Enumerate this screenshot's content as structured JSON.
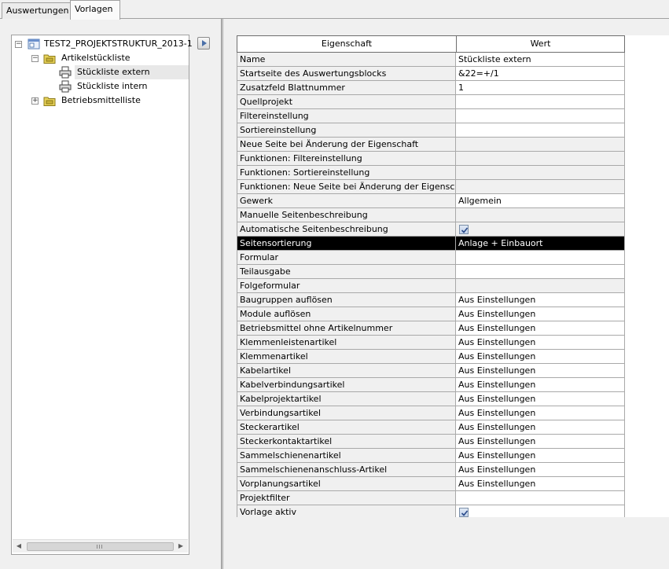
{
  "tabs": [
    {
      "label": "Auswertungen",
      "active": false
    },
    {
      "label": "Vorlagen",
      "active": true
    }
  ],
  "tree": {
    "root": "TEST2_PROJEKTSTRUKTUR_2013-1",
    "items": [
      {
        "label": "Artikelstückliste",
        "expander": "−"
      },
      {
        "label": "Stückliste extern",
        "selected": true
      },
      {
        "label": "Stückliste intern"
      },
      {
        "label": "Betriebsmittelliste",
        "expander": "+"
      }
    ]
  },
  "grid": {
    "header": {
      "property": "Eigenschaft",
      "value": "Wert"
    },
    "rows": [
      {
        "property": "Name",
        "value": "Stückliste extern"
      },
      {
        "property": "Startseite des Auswertungsblocks",
        "value": "&22=+/1"
      },
      {
        "property": "Zusatzfeld Blattnummer",
        "value": "1"
      },
      {
        "property": "Quellprojekt",
        "value": ""
      },
      {
        "property": "Filtereinstellung",
        "value": ""
      },
      {
        "property": "Sortiereinstellung",
        "value": ""
      },
      {
        "property": "Neue Seite bei Änderung der Eigenschaft",
        "value": "",
        "gray": true
      },
      {
        "property": "Funktionen: Filtereinstellung",
        "value": "",
        "gray": true
      },
      {
        "property": "Funktionen: Sortiereinstellung",
        "value": "",
        "gray": true
      },
      {
        "property": "Funktionen: Neue Seite bei Änderung der Eigensc...",
        "value": "",
        "gray": true
      },
      {
        "property": "Gewerk",
        "value": "Allgemein"
      },
      {
        "property": "Manuelle Seitenbeschreibung",
        "value": "",
        "gray": true
      },
      {
        "property": "Automatische Seitenbeschreibung",
        "value": "",
        "checkbox": true,
        "gray": true
      },
      {
        "property": "Seitensortierung",
        "value": "Anlage + Einbauort",
        "highlight": true
      },
      {
        "property": "Formular",
        "value": ""
      },
      {
        "property": "Teilausgabe",
        "value": ""
      },
      {
        "property": "Folgeformular",
        "value": "",
        "gray": true
      },
      {
        "property": "Baugruppen auflösen",
        "value": "Aus Einstellungen"
      },
      {
        "property": "Module auflösen",
        "value": "Aus Einstellungen"
      },
      {
        "property": "Betriebsmittel ohne Artikelnummer",
        "value": "Aus Einstellungen"
      },
      {
        "property": "Klemmenleistenartikel",
        "value": "Aus Einstellungen"
      },
      {
        "property": "Klemmenartikel",
        "value": "Aus Einstellungen"
      },
      {
        "property": "Kabelartikel",
        "value": "Aus Einstellungen"
      },
      {
        "property": "Kabelverbindungsartikel",
        "value": "Aus Einstellungen"
      },
      {
        "property": "Kabelprojektartikel",
        "value": "Aus Einstellungen"
      },
      {
        "property": "Verbindungsartikel",
        "value": "Aus Einstellungen"
      },
      {
        "property": "Steckerartikel",
        "value": "Aus Einstellungen"
      },
      {
        "property": "Steckerkontaktartikel",
        "value": "Aus Einstellungen"
      },
      {
        "property": "Sammelschienenartikel",
        "value": "Aus Einstellungen"
      },
      {
        "property": "Sammelschienenanschluss-Artikel",
        "value": "Aus Einstellungen"
      },
      {
        "property": "Vorplanungsartikel",
        "value": "Aus Einstellungen"
      },
      {
        "property": "Projektfilter",
        "value": ""
      },
      {
        "property": "Vorlage aktiv",
        "value": "",
        "checkbox": true
      }
    ]
  },
  "colors": {
    "highlight": "#000000",
    "selection": "#e8e8e8",
    "checkbox": "#c2d2ea"
  }
}
